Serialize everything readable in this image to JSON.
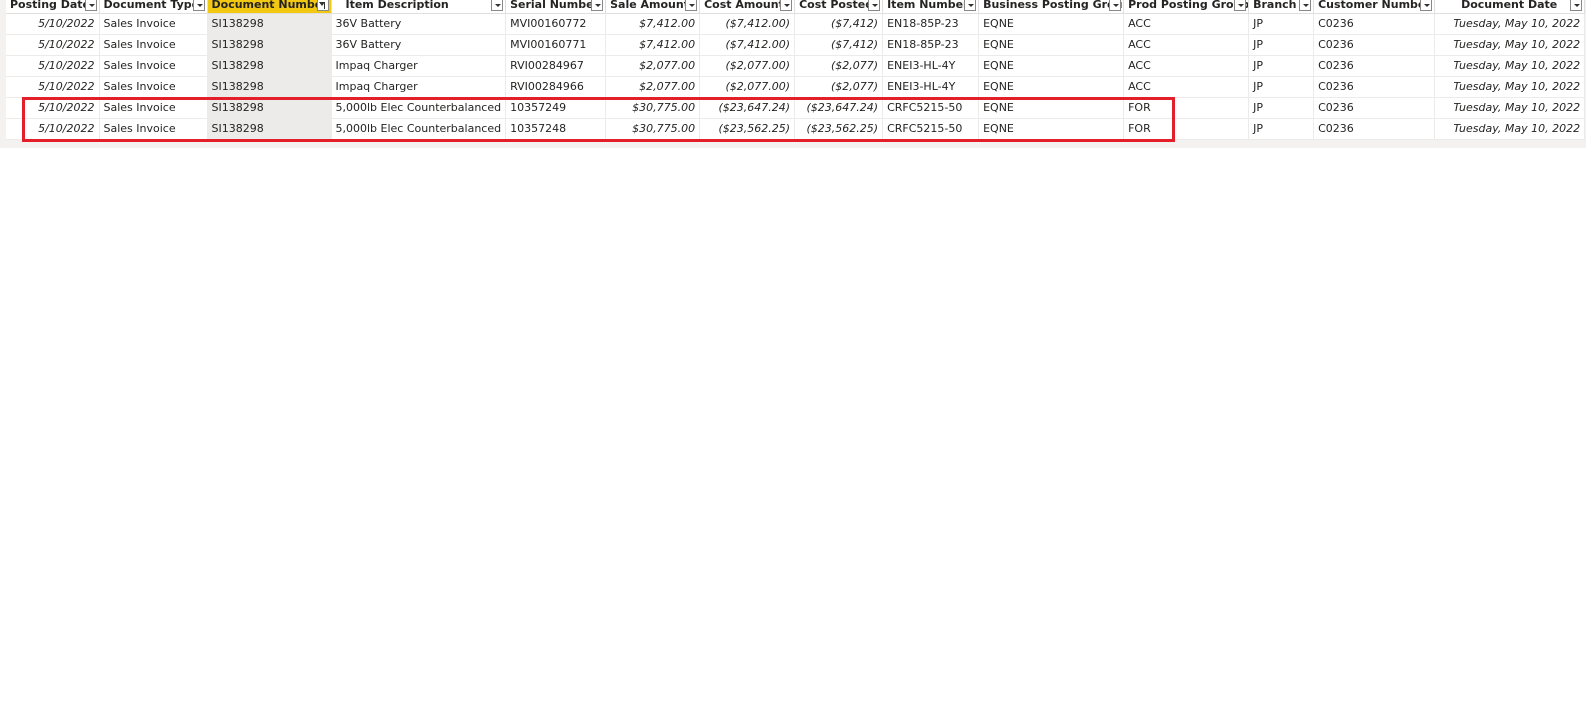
{
  "columns": [
    {
      "label": "Posting Date"
    },
    {
      "label": "Document Type"
    },
    {
      "label": "Document Number"
    },
    {
      "label": "Item Description"
    },
    {
      "label": "Serial Number"
    },
    {
      "label": "Sale Amount"
    },
    {
      "label": "Cost Amount"
    },
    {
      "label": "Cost Posted"
    },
    {
      "label": "Item Number"
    },
    {
      "label": "Business Posting Group"
    },
    {
      "label": "Prod Posting Group"
    },
    {
      "label": "Branch"
    },
    {
      "label": "Customer Number"
    },
    {
      "label": "Document Date"
    }
  ],
  "filtered_column": "Document Number",
  "rows": [
    [
      "5/10/2022",
      "Sales Invoice",
      "SI138298",
      "36V Battery",
      "MVI00160772",
      "$7,412.00",
      "($7,412.00)",
      "($7,412)",
      "EN18-85P-23",
      "EQNE",
      "ACC",
      "JP",
      "C0236",
      "Tuesday, May 10, 2022"
    ],
    [
      "5/10/2022",
      "Sales Invoice",
      "SI138298",
      "36V Battery",
      "MVI00160771",
      "$7,412.00",
      "($7,412.00)",
      "($7,412)",
      "EN18-85P-23",
      "EQNE",
      "ACC",
      "JP",
      "C0236",
      "Tuesday, May 10, 2022"
    ],
    [
      "5/10/2022",
      "Sales Invoice",
      "SI138298",
      "Impaq Charger",
      "RVI00284967",
      "$2,077.00",
      "($2,077.00)",
      "($2,077)",
      "ENEI3-HL-4Y",
      "EQNE",
      "ACC",
      "JP",
      "C0236",
      "Tuesday, May 10, 2022"
    ],
    [
      "5/10/2022",
      "Sales Invoice",
      "SI138298",
      "Impaq Charger",
      "RVI00284966",
      "$2,077.00",
      "($2,077.00)",
      "($2,077)",
      "ENEI3-HL-4Y",
      "EQNE",
      "ACC",
      "JP",
      "C0236",
      "Tuesday, May 10, 2022"
    ],
    [
      "5/10/2022",
      "Sales Invoice",
      "SI138298",
      "5,000lb Elec Counterbalanced",
      "10357249",
      "$30,775.00",
      "($23,647.24)",
      "($23,647.24)",
      "CRFC5215-50",
      "EQNE",
      "FOR",
      "JP",
      "C0236",
      "Tuesday, May 10, 2022"
    ],
    [
      "5/10/2022",
      "Sales Invoice",
      "SI138298",
      "5,000lb Elec Counterbalanced",
      "10357248",
      "$30,775.00",
      "($23,562.25)",
      "($23,562.25)",
      "CRFC5215-50",
      "EQNE",
      "FOR",
      "JP",
      "C0236",
      "Tuesday, May 10, 2022"
    ]
  ],
  "highlight_color": "#e3202a",
  "filter_accent": "#f2c811"
}
